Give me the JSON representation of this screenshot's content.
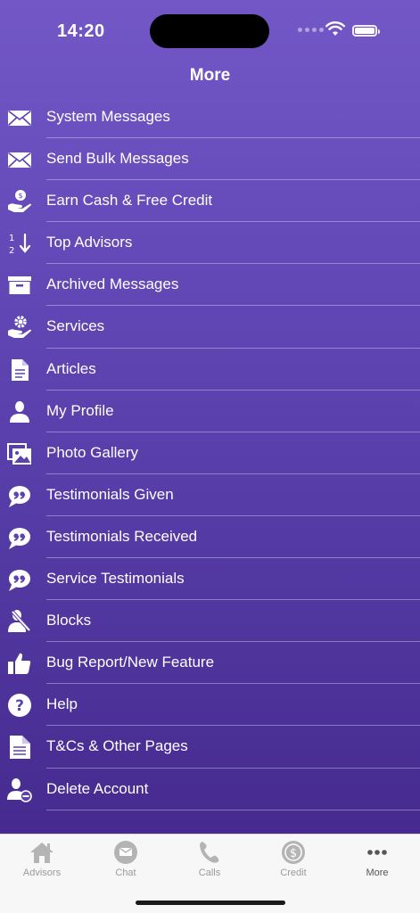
{
  "status": {
    "time": "14:20"
  },
  "header": {
    "title": "More"
  },
  "menu": [
    {
      "label": "System Messages",
      "icon": "envelope-icon"
    },
    {
      "label": "Send Bulk Messages",
      "icon": "envelope-icon"
    },
    {
      "label": "Earn Cash & Free Credit",
      "icon": "hand-coin-icon"
    },
    {
      "label": "Top Advisors",
      "icon": "sort-numeric-icon"
    },
    {
      "label": "Archived Messages",
      "icon": "archive-box-icon"
    },
    {
      "label": "Services",
      "icon": "hand-gear-icon"
    },
    {
      "label": "Articles",
      "icon": "document-icon"
    },
    {
      "label": "My Profile",
      "icon": "user-icon"
    },
    {
      "label": "Photo Gallery",
      "icon": "photos-icon"
    },
    {
      "label": "Testimonials Given",
      "icon": "quote-bubble-icon"
    },
    {
      "label": "Testimonials Received",
      "icon": "quote-bubble-icon"
    },
    {
      "label": "Service Testimonials",
      "icon": "quote-bubble-icon"
    },
    {
      "label": "Blocks",
      "icon": "block-user-icon"
    },
    {
      "label": "Bug Report/New Feature",
      "icon": "thumbs-up-icon"
    },
    {
      "label": "Help",
      "icon": "question-circle-icon"
    },
    {
      "label": "T&Cs & Other Pages",
      "icon": "document-lines-icon"
    },
    {
      "label": "Delete Account",
      "icon": "user-minus-icon"
    }
  ],
  "tabs": [
    {
      "label": "Advisors",
      "icon": "house-icon",
      "active": false
    },
    {
      "label": "Chat",
      "icon": "chat-bubble-icon",
      "active": false
    },
    {
      "label": "Calls",
      "icon": "phone-icon",
      "active": false
    },
    {
      "label": "Credit",
      "icon": "dollar-coin-icon",
      "active": false
    },
    {
      "label": "More",
      "icon": "more-dots-icon",
      "active": true
    }
  ],
  "colors": {
    "gradient_top": "#7357c7",
    "gradient_bottom": "#462a8f",
    "tab_inactive": "#9a9a9a",
    "tab_active": "#555555"
  }
}
